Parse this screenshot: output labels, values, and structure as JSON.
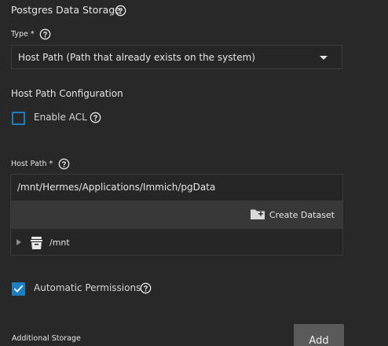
{
  "section": {
    "title": "Postgres Data Storage"
  },
  "type_field": {
    "label": "Type *",
    "value": "Host Path (Path that already exists on the system)"
  },
  "host_path_config": {
    "title": "Host Path Configuration",
    "enable_acl_label": "Enable ACL",
    "enable_acl_checked": false
  },
  "host_path": {
    "label": "Host Path *",
    "value": "/mnt/Hermes/Applications/Immich/pgData",
    "create_dataset_label": "Create Dataset",
    "tree_root": "/mnt"
  },
  "automatic_permissions": {
    "label": "Automatic Permissions",
    "checked": true
  },
  "additional_storage": {
    "label": "Additional Storage",
    "add_label": "Add"
  },
  "icons": {
    "help": "help-circle-icon",
    "caret": "caret-down-icon",
    "create_dataset": "folder-plus-icon",
    "tree_toggle": "triangle-right-icon",
    "tree_item": "dataset-icon",
    "check": "checkmark-icon"
  },
  "colors": {
    "background": "#282828",
    "accent": "#1c7fc1",
    "border": "#3c3c3c",
    "toolbar": "#383838",
    "button": "#5a5a5a"
  }
}
